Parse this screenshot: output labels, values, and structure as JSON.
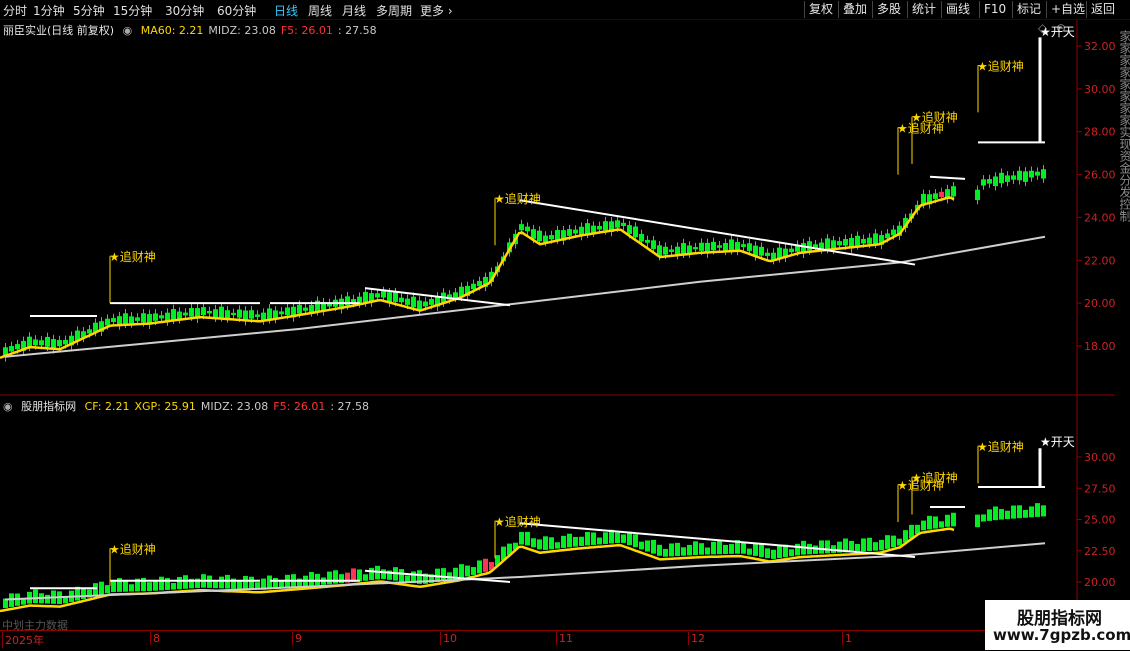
{
  "toolbar": {
    "tabs": [
      {
        "label": "分时"
      },
      {
        "label": "1分钟"
      },
      {
        "label": "5分钟"
      },
      {
        "label": "15分钟"
      },
      {
        "label": "30分钟"
      },
      {
        "label": "60分钟"
      },
      {
        "label": "日线"
      },
      {
        "label": "周线"
      },
      {
        "label": "月线"
      },
      {
        "label": "多周期"
      },
      {
        "label": "更多"
      }
    ],
    "active_tab": "日线",
    "right_buttons": [
      {
        "label": "复权"
      },
      {
        "label": "叠加"
      },
      {
        "label": "多股"
      },
      {
        "label": "统计"
      },
      {
        "label": "画线"
      },
      {
        "label": "F10"
      },
      {
        "label": "标记"
      },
      {
        "label": "+自选"
      },
      {
        "label": "返回"
      }
    ]
  },
  "main_panel": {
    "title": "丽臣实业(日线 前复权)",
    "indicators": [
      {
        "text": "MA60: 2.21",
        "color": "#ffd700"
      },
      {
        "text": "MIDZ: 23.08",
        "color": "#c8c8c8"
      },
      {
        "text": "F5: 26.01",
        "color": "#ff3333"
      },
      {
        "text": ": 27.58",
        "color": "#c8c8c8"
      }
    ],
    "y_ticks": [
      "32.00",
      "30.00",
      "28.00",
      "26.00",
      "24.00",
      "22.00",
      "20.00",
      "18.00"
    ]
  },
  "sub_panel": {
    "title": "股朋指标网",
    "indicators": [
      {
        "text": "CF: 2.21",
        "color": "#ffd700"
      },
      {
        "text": "XGP: 25.91",
        "color": "#ffd700"
      },
      {
        "text": "MIDZ: 23.08",
        "color": "#c8c8c8"
      },
      {
        "text": "F5: 26.01",
        "color": "#ff3333"
      },
      {
        "text": ": 27.58",
        "color": "#c8c8c8"
      }
    ],
    "y_ticks": [
      "30.00",
      "27.50",
      "25.00",
      "22.50",
      "20.00"
    ]
  },
  "signals": {
    "buy_label": "追财神",
    "open_label": "开天"
  },
  "x_axis": {
    "labels": [
      "2025年",
      "8",
      "9",
      "10",
      "11",
      "12",
      "1"
    ],
    "footer_note": "中划主力数据"
  },
  "sidebar": {
    "text": "家家家家家家家家实现资金分发控制"
  },
  "watermark": {
    "title": "股朋指标网",
    "url": "www.7gpzb.com"
  },
  "colors": {
    "up": "#00ff33",
    "down": "#00dd22",
    "accent": "#ffd700",
    "ma_line": "#ffd700",
    "mid_line": "#d0d0d0",
    "signal": "#ffd700",
    "resist": "#ffffff",
    "bull": "#ff3333"
  }
}
